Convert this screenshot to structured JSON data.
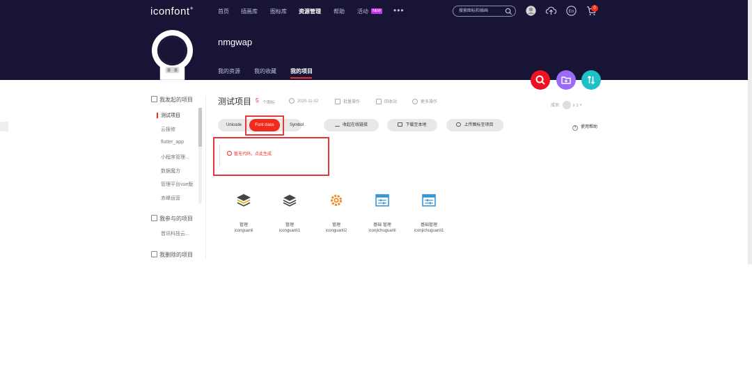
{
  "header": {
    "logo": "iconfont",
    "logo_sup": "+",
    "nav": [
      "首页",
      "插画库",
      "图标库",
      "资源管理",
      "帮助",
      "活动"
    ],
    "nav_new_badge": "NEW",
    "more": "•••",
    "search_placeholder": "搜索图标和插画",
    "cart_count": "0"
  },
  "profile": {
    "username": "nmgwap",
    "tabs": [
      "我的资源",
      "我的收藏",
      "我的项目"
    ],
    "active_tab": "我的项目"
  },
  "sidebar": {
    "section1_title": "我发起的项目",
    "projects": [
      "测试项目",
      "云报修",
      "flutter_app",
      "小程序管理...",
      "数据魔方",
      "管理平台vue版",
      "赤峰运营"
    ],
    "section2_title": "我参与的项目",
    "joined": [
      "晋讯科技云..."
    ],
    "section3_title": "我删除的项目"
  },
  "project": {
    "title": "测试项目",
    "count": "5",
    "count_label": "个图标",
    "date": "2020-11-02",
    "batch": "批量操作",
    "trash": "回收站",
    "more_ops": "更多操作",
    "members_label": "成员:",
    "members_count": "x 1"
  },
  "toolbar": {
    "tabs": [
      "Unicode",
      "Font class",
      "Symbol"
    ],
    "active_tab": "Font class",
    "view_online": "收起在线链接",
    "download": "下载至本地",
    "upload": "上传图标至项目",
    "help": "使用帮助",
    "help_icon_char": "?"
  },
  "notice": {
    "text": "暂无代码，点此生成"
  },
  "icons": [
    {
      "name": "管理",
      "code": "iconguanli",
      "color": "#444444"
    },
    {
      "name": "管理",
      "code": "iconguanli1",
      "color": "#444444"
    },
    {
      "name": "管理",
      "code": "iconguanli2",
      "color": "#f08a24"
    },
    {
      "name": "基础 管理",
      "code": "iconjichuguanli",
      "color": "#3b96d8"
    },
    {
      "name": "基础管理",
      "code": "iconjichuguanli1",
      "color": "#3b96d8"
    }
  ],
  "colors": {
    "header_bg": "#171436",
    "accent_red": "#f12c1d",
    "fab_red": "#ee1122",
    "fab_purple": "#9a6cf5",
    "fab_teal": "#20c0c8",
    "highlight": "#e8363c"
  }
}
